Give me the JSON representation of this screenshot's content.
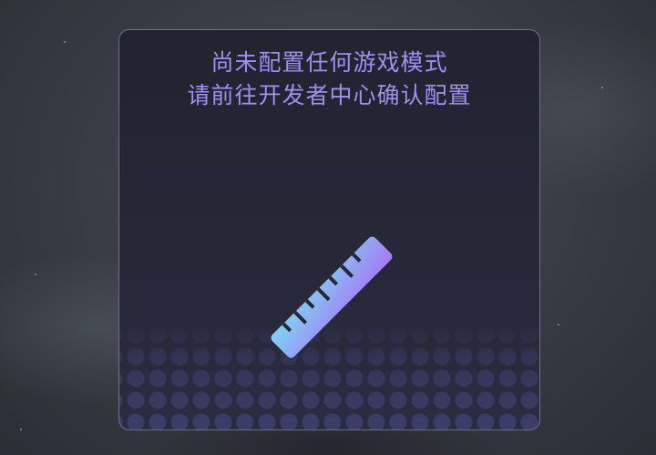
{
  "dialog": {
    "message_line_1": "尚未配置任何游戏模式",
    "message_line_2": "请前往开发者中心确认配置",
    "icon": "ruler-pencil-icon"
  },
  "colors": {
    "text_accent": "#a08ff2",
    "icon_gradient_start": "#7fd3f7",
    "icon_gradient_end": "#a679f2",
    "card_background": "#262838"
  }
}
